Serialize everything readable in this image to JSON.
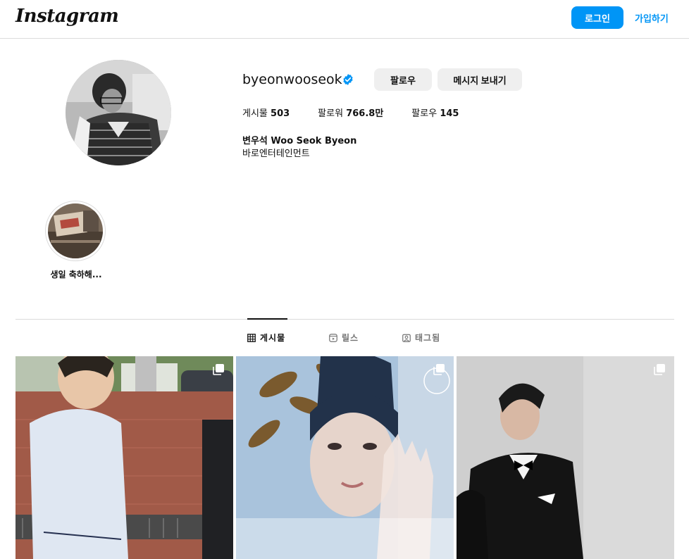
{
  "header": {
    "logo_text": "Instagram",
    "login_label": "로그인",
    "signup_label": "가입하기"
  },
  "profile": {
    "username": "byeonwooseok",
    "verified": true,
    "follow_label": "팔로우",
    "message_label": "메시지 보내기",
    "stats": [
      {
        "label": "게시물",
        "value": "503"
      },
      {
        "label": "팔로워",
        "value": "766.8만"
      },
      {
        "label": "팔로우",
        "value": "145"
      }
    ],
    "full_name": "변우석 Woo Seok Byeon",
    "bio": "바로엔터테인먼트"
  },
  "highlights": [
    {
      "label": "생일 축하해..."
    }
  ],
  "tabs": [
    {
      "label": "게시물",
      "icon": "grid-icon",
      "active": true
    },
    {
      "label": "릴스",
      "icon": "reels-icon",
      "active": false
    },
    {
      "label": "태그됨",
      "icon": "tagged-icon",
      "active": false
    }
  ],
  "posts": [
    {
      "icon": "multiple-photos-icon"
    },
    {
      "icon": "multiple-photos-icon"
    },
    {
      "icon": "multiple-photos-icon"
    }
  ],
  "colors": {
    "accent": "#0095f6",
    "verified": "#0095f6",
    "secondary_button": "#efefef",
    "border": "#dbdbdb"
  }
}
